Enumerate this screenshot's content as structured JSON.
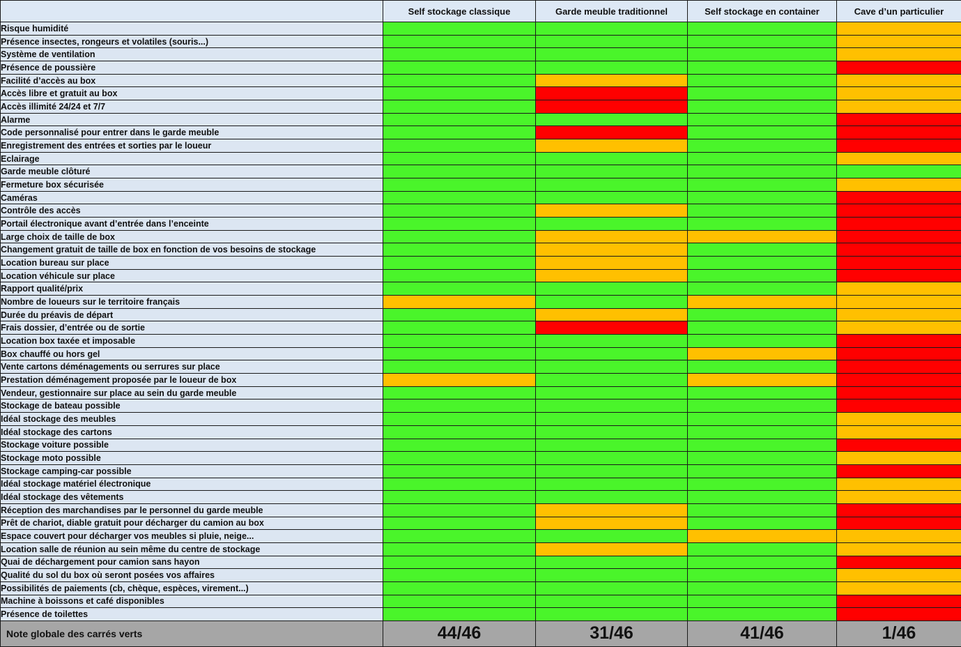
{
  "chart_data": {
    "type": "table",
    "columns": [
      "Self stockage classique",
      "Garde meuble traditionnel",
      "Self stockage en container",
      "Cave d’un particulier"
    ],
    "colors": {
      "green": "#4af52a",
      "orange": "#ffc000",
      "red": "#ff0000"
    },
    "rows": [
      {
        "label": "Risque humidité",
        "ratings": [
          "green",
          "green",
          "green",
          "orange"
        ]
      },
      {
        "label": "Présence insectes, rongeurs et volatiles (souris...)",
        "ratings": [
          "green",
          "green",
          "green",
          "orange"
        ]
      },
      {
        "label": "Système de ventilation",
        "ratings": [
          "green",
          "green",
          "green",
          "orange"
        ]
      },
      {
        "label": "Présence de poussière",
        "ratings": [
          "green",
          "green",
          "green",
          "red"
        ]
      },
      {
        "label": "Facilité d’accès au box",
        "ratings": [
          "green",
          "orange",
          "green",
          "orange"
        ]
      },
      {
        "label": "Accès libre et gratuit au box",
        "ratings": [
          "green",
          "red",
          "green",
          "orange"
        ]
      },
      {
        "label": "Accès illimité 24/24 et 7/7",
        "ratings": [
          "green",
          "red",
          "green",
          "orange"
        ]
      },
      {
        "label": "Alarme",
        "ratings": [
          "green",
          "green",
          "green",
          "red"
        ]
      },
      {
        "label": "Code personnalisé pour entrer dans le garde meuble",
        "ratings": [
          "green",
          "red",
          "green",
          "red"
        ]
      },
      {
        "label": "Enregistrement des entrées et sorties par le loueur",
        "ratings": [
          "green",
          "orange",
          "green",
          "red"
        ]
      },
      {
        "label": "Eclairage",
        "ratings": [
          "green",
          "green",
          "green",
          "orange"
        ]
      },
      {
        "label": "Garde meuble clôturé",
        "ratings": [
          "green",
          "green",
          "green",
          "green"
        ]
      },
      {
        "label": "Fermeture box sécurisée",
        "ratings": [
          "green",
          "green",
          "green",
          "orange"
        ]
      },
      {
        "label": "Caméras",
        "ratings": [
          "green",
          "green",
          "green",
          "red"
        ]
      },
      {
        "label": "Contrôle des accès",
        "ratings": [
          "green",
          "orange",
          "green",
          "red"
        ]
      },
      {
        "label": "Portail électronique avant d’entrée dans l’enceinte",
        "ratings": [
          "green",
          "green",
          "green",
          "red"
        ]
      },
      {
        "label": "Large choix de taille de box",
        "ratings": [
          "green",
          "orange",
          "orange",
          "red"
        ]
      },
      {
        "label": "Changement gratuit de taille de box en fonction de vos besoins de stockage",
        "ratings": [
          "green",
          "orange",
          "green",
          "red"
        ]
      },
      {
        "label": "Location bureau sur place",
        "ratings": [
          "green",
          "orange",
          "green",
          "red"
        ]
      },
      {
        "label": "Location véhicule sur place",
        "ratings": [
          "green",
          "orange",
          "green",
          "red"
        ]
      },
      {
        "label": "Rapport qualité/prix",
        "ratings": [
          "green",
          "green",
          "green",
          "orange"
        ]
      },
      {
        "label": "Nombre de loueurs sur le territoire français",
        "ratings": [
          "orange",
          "green",
          "orange",
          "orange"
        ]
      },
      {
        "label": "Durée du préavis de départ",
        "ratings": [
          "green",
          "orange",
          "green",
          "orange"
        ]
      },
      {
        "label": "Frais dossier, d’entrée ou de sortie",
        "ratings": [
          "green",
          "red",
          "green",
          "orange"
        ]
      },
      {
        "label": "Location box taxée et imposable",
        "ratings": [
          "green",
          "green",
          "green",
          "red"
        ]
      },
      {
        "label": "Box chauffé ou hors gel",
        "ratings": [
          "green",
          "green",
          "orange",
          "red"
        ]
      },
      {
        "label": "Vente cartons déménagements ou serrures sur place",
        "ratings": [
          "green",
          "green",
          "green",
          "red"
        ]
      },
      {
        "label": "Prestation déménagement proposée par le loueur de box",
        "ratings": [
          "orange",
          "green",
          "orange",
          "red"
        ]
      },
      {
        "label": "Vendeur, gestionnaire sur place au sein du garde meuble",
        "ratings": [
          "green",
          "green",
          "green",
          "red"
        ]
      },
      {
        "label": "Stockage de bateau possible",
        "ratings": [
          "green",
          "green",
          "green",
          "red"
        ]
      },
      {
        "label": "Idéal stockage des meubles",
        "ratings": [
          "green",
          "green",
          "green",
          "orange"
        ]
      },
      {
        "label": "Idéal stockage des cartons",
        "ratings": [
          "green",
          "green",
          "green",
          "orange"
        ]
      },
      {
        "label": "Stockage voiture possible",
        "ratings": [
          "green",
          "green",
          "green",
          "red"
        ]
      },
      {
        "label": "Stockage moto possible",
        "ratings": [
          "green",
          "green",
          "green",
          "orange"
        ]
      },
      {
        "label": "Stockage camping-car possible",
        "ratings": [
          "green",
          "green",
          "green",
          "red"
        ]
      },
      {
        "label": "Idéal stockage matériel électronique",
        "ratings": [
          "green",
          "green",
          "green",
          "orange"
        ]
      },
      {
        "label": "Idéal stockage des vêtements",
        "ratings": [
          "green",
          "green",
          "green",
          "orange"
        ]
      },
      {
        "label": "Réception des marchandises par le personnel du  garde meuble",
        "ratings": [
          "green",
          "orange",
          "green",
          "red"
        ]
      },
      {
        "label": "Prêt de chariot, diable gratuit pour décharger du camion au box",
        "ratings": [
          "green",
          "orange",
          "green",
          "red"
        ]
      },
      {
        "label": "Espace couvert pour décharger vos meubles si pluie, neige...",
        "ratings": [
          "green",
          "green",
          "orange",
          "orange"
        ]
      },
      {
        "label": "Location salle de réunion au sein même du centre de stockage",
        "ratings": [
          "green",
          "orange",
          "green",
          "orange"
        ]
      },
      {
        "label": "Quai de déchargement pour camion sans hayon",
        "ratings": [
          "green",
          "green",
          "green",
          "red"
        ]
      },
      {
        "label": "Qualité du sol du box où seront posées vos affaires",
        "ratings": [
          "green",
          "green",
          "green",
          "orange"
        ]
      },
      {
        "label": "Possibilités de paiements (cb, chèque, espèces, virement...)",
        "ratings": [
          "green",
          "green",
          "green",
          "orange"
        ]
      },
      {
        "label": "Machine à boissons et café disponibles",
        "ratings": [
          "green",
          "green",
          "green",
          "red"
        ]
      },
      {
        "label": "Présence de toilettes",
        "ratings": [
          "green",
          "green",
          "green",
          "red"
        ]
      }
    ],
    "total_label": "Note globale des carrés verts",
    "totals": [
      "44/46",
      "31/46",
      "41/46",
      "1/46"
    ]
  }
}
